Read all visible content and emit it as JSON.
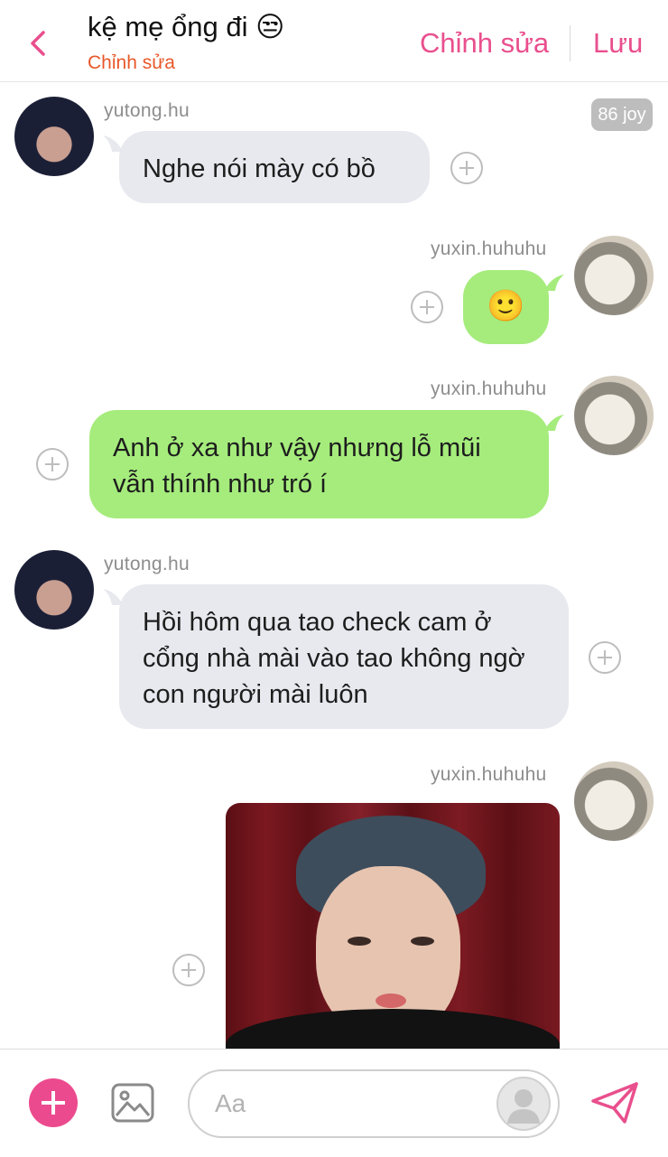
{
  "header": {
    "title": "kệ mẹ ổng đi 😒",
    "subtitle": "Chỉnh sửa",
    "edit_label": "Chỉnh sửa",
    "save_label": "Lưu"
  },
  "badge": "86 joy",
  "messages": [
    {
      "sender": "yutong.hu",
      "text": "Nghe nói mày có bồ"
    },
    {
      "sender": "yuxin.huhuhu",
      "text": "🙂"
    },
    {
      "sender": "yuxin.huhuhu",
      "text": "Anh ở xa như vậy nhưng lỗ mũi vẫn thính như tró í"
    },
    {
      "sender": "yutong.hu",
      "text": "Hồi hôm qua tao check cam ở cổng nhà mài vào tao không ngờ con người mài luôn"
    },
    {
      "sender": "yuxin.huhuhu",
      "text": ""
    }
  ],
  "composer": {
    "placeholder": "Aa"
  },
  "colors": {
    "accent": "#e94f8d",
    "subtitle": "#e8582a",
    "incoming_bubble": "#e7e9ee",
    "outgoing_bubble": "#a5ec7c"
  },
  "icons": {
    "back": "chevron-left-icon",
    "add": "plus-icon",
    "image": "image-icon",
    "voice": "avatar-placeholder-icon",
    "send": "send-icon",
    "react": "add-reaction-icon"
  }
}
